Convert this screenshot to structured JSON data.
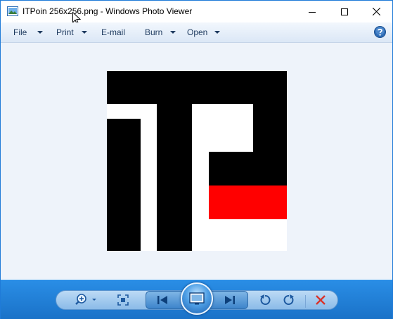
{
  "window": {
    "title": "ITPoin 256x256.png - Windows Photo Viewer"
  },
  "menu": {
    "items": [
      {
        "label": "File"
      },
      {
        "label": "Print"
      },
      {
        "label": "E-mail"
      },
      {
        "label": "Burn"
      },
      {
        "label": "Open"
      }
    ]
  },
  "image": {
    "description_colors": {
      "black": "#000000",
      "white": "#ffffff",
      "red": "#ff0000"
    }
  },
  "toolbar": {
    "icons": [
      "zoom-icon",
      "actual-size-icon",
      "previous-icon",
      "slideshow-icon",
      "next-icon",
      "rotate-counterclockwise-icon",
      "rotate-clockwise-icon",
      "delete-icon"
    ]
  },
  "colors": {
    "toolbar_blue": "#1f7bd8",
    "menubar": "#dbe7f6",
    "viewer_bg": "#eef3fa",
    "delete_red": "#d9342b"
  }
}
